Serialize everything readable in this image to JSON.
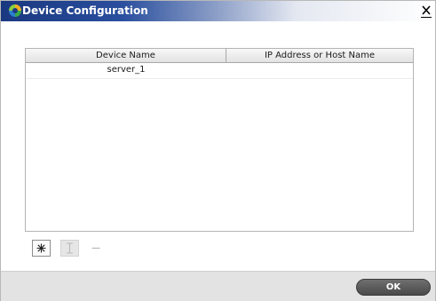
{
  "window": {
    "title": "Device Configuration",
    "icon": "app-logo-icon",
    "close_icon": "close-icon"
  },
  "table": {
    "columns": [
      "Device Name",
      "IP Address or Host Name"
    ],
    "rows": [
      {
        "device_name": "server_1",
        "ip_address": ""
      }
    ]
  },
  "toolbar": {
    "add_icon": "asterisk-add-icon",
    "edit_icon": "text-cursor-edit-icon",
    "remove_icon": "minus-remove-icon"
  },
  "footer": {
    "ok_label": "OK"
  },
  "colors": {
    "title_gradient_start": "#1a3880",
    "ok_button": "#5a5a5a"
  }
}
